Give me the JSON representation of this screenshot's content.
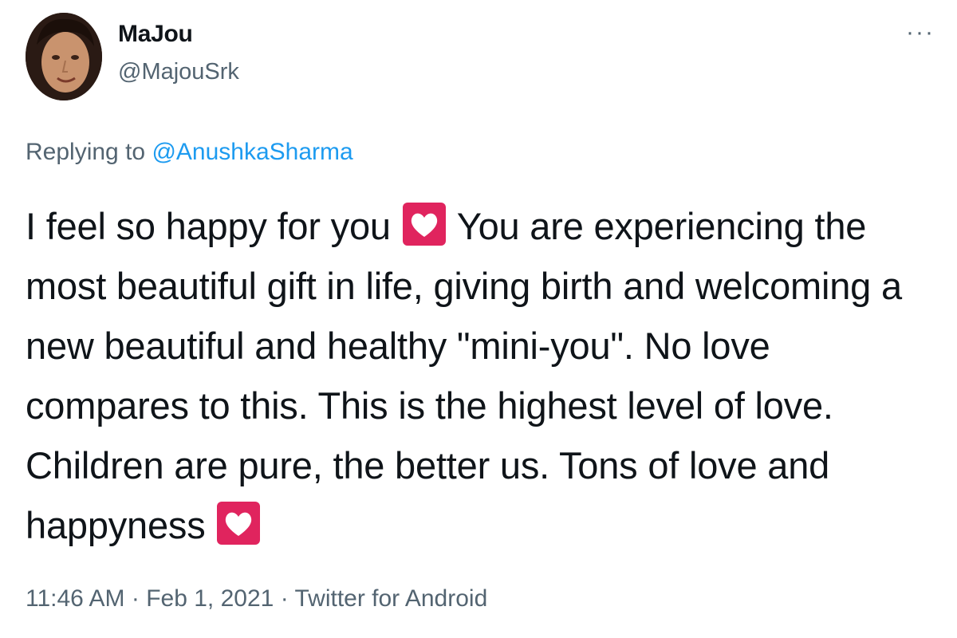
{
  "user": {
    "display_name": "MaJou",
    "handle": "@MajouSrk",
    "avatar_icon": "profile-photo"
  },
  "menu": {
    "more_icon": "ellipsis-icon",
    "more_glyph": "···"
  },
  "reply": {
    "prefix": "Replying to",
    "mention": "@AnushkaSharma"
  },
  "tweet": {
    "part1": "I feel so happy for you",
    "part2": "You are experiencing the most beautiful gift in life, giving birth and welcoming a new beautiful and healthy \"mini-you\". No love compares to this. This is the highest level of love. Children are pure, the better us. Tons of love and happyness",
    "emoji_icon": "white-heart-emoji"
  },
  "meta": {
    "time": "11:46 AM",
    "separator": "·",
    "date": "Feb 1, 2021",
    "source": "Twitter for Android"
  },
  "colors": {
    "text": "#0f1419",
    "secondary": "#536471",
    "link": "#1d9bf0",
    "emoji_bg": "#e0245e"
  }
}
